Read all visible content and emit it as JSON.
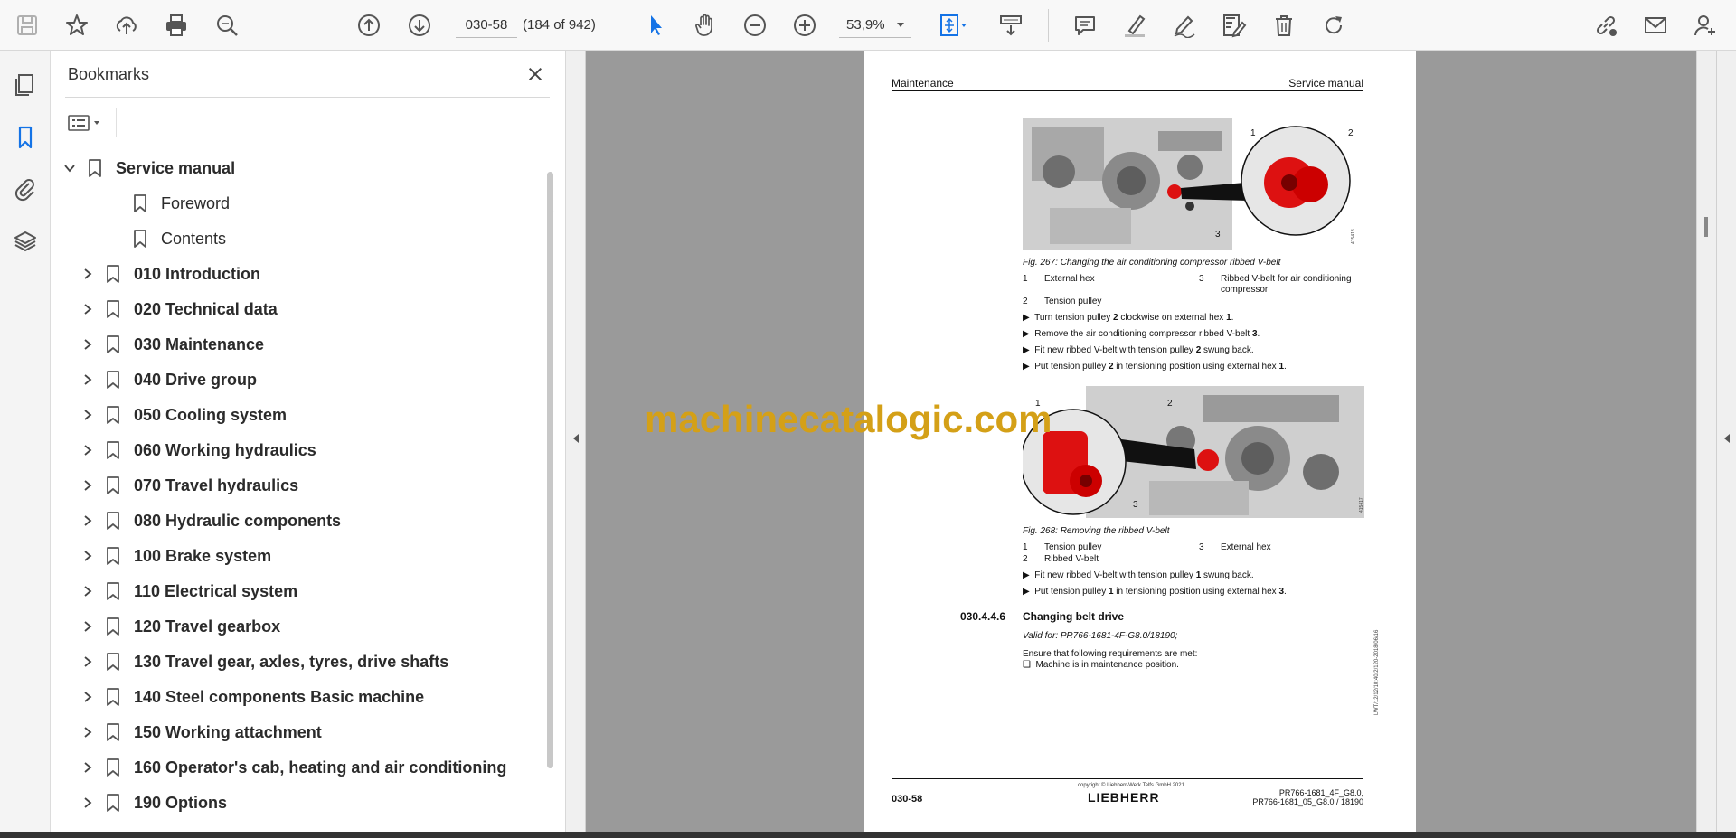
{
  "toolbar": {
    "page_number": "030-58",
    "page_count": "(184 of 942)",
    "zoom": "53,9%"
  },
  "bookmarks": {
    "title": "Bookmarks",
    "items": [
      {
        "label": "Service manual",
        "bold": true,
        "level": 0,
        "expanded": true
      },
      {
        "label": "Foreword",
        "bold": false,
        "level": 1,
        "expandable": false
      },
      {
        "label": "Contents",
        "bold": false,
        "level": 1,
        "expandable": false
      },
      {
        "label": "010 Introduction",
        "bold": true,
        "level": 1,
        "expandable": true
      },
      {
        "label": "020 Technical data",
        "bold": true,
        "level": 1,
        "expandable": true
      },
      {
        "label": "030 Maintenance",
        "bold": true,
        "level": 1,
        "expandable": true
      },
      {
        "label": "040 Drive group",
        "bold": true,
        "level": 1,
        "expandable": true
      },
      {
        "label": "050 Cooling system",
        "bold": true,
        "level": 1,
        "expandable": true
      },
      {
        "label": "060 Working hydraulics",
        "bold": true,
        "level": 1,
        "expandable": true
      },
      {
        "label": "070 Travel hydraulics",
        "bold": true,
        "level": 1,
        "expandable": true
      },
      {
        "label": "080 Hydraulic components",
        "bold": true,
        "level": 1,
        "expandable": true
      },
      {
        "label": "100 Brake system",
        "bold": true,
        "level": 1,
        "expandable": true
      },
      {
        "label": "110 Electrical system",
        "bold": true,
        "level": 1,
        "expandable": true
      },
      {
        "label": "120 Travel gearbox",
        "bold": true,
        "level": 1,
        "expandable": true
      },
      {
        "label": "130 Travel gear, axles, tyres, drive shafts",
        "bold": true,
        "level": 1,
        "expandable": true
      },
      {
        "label": "140 Steel components Basic machine",
        "bold": true,
        "level": 1,
        "expandable": true
      },
      {
        "label": "150 Working attachment",
        "bold": true,
        "level": 1,
        "expandable": true
      },
      {
        "label": "160 Operator's cab, heating and air conditioning",
        "bold": true,
        "level": 1,
        "expandable": true
      },
      {
        "label": "190 Options",
        "bold": true,
        "level": 1,
        "expandable": true
      }
    ]
  },
  "document": {
    "header_left": "Maintenance",
    "header_right": "Service manual",
    "fig1": {
      "caption": "Fig. 267: Changing the air conditioning compressor ribbed V-belt",
      "id": "415418",
      "callouts": [
        "1",
        "2",
        "3"
      ],
      "legend": [
        {
          "n": "1",
          "text": "External hex"
        },
        {
          "n": "3",
          "text": "Ribbed V-belt for air conditioning compressor"
        },
        {
          "n": "2",
          "text": "Tension pulley"
        }
      ],
      "steps": [
        {
          "pre": "Turn tension pulley ",
          "b": "2",
          "mid": " clockwise on external hex ",
          "b2": "1",
          "post": "."
        },
        {
          "pre": "Remove the air conditioning compressor ribbed V-belt ",
          "b": "3",
          "mid": ".",
          "b2": "",
          "post": ""
        },
        {
          "pre": "Fit new ribbed V-belt with tension pulley ",
          "b": "2",
          "mid": " swung back.",
          "b2": "",
          "post": ""
        },
        {
          "pre": "Put tension pulley ",
          "b": "2",
          "mid": " in tensioning position using external hex ",
          "b2": "1",
          "post": "."
        }
      ]
    },
    "fig2": {
      "caption": "Fig. 268: Removing the ribbed V-belt",
      "id": "415417",
      "callouts": [
        "1",
        "2",
        "3"
      ],
      "legend": [
        {
          "n": "1",
          "text": "Tension pulley"
        },
        {
          "n": "3",
          "text": "External hex"
        },
        {
          "n": "2",
          "text": "Ribbed V-belt"
        }
      ],
      "steps": [
        {
          "pre": "Fit new ribbed V-belt with tension pulley ",
          "b": "1",
          "mid": " swung back.",
          "b2": "",
          "post": ""
        },
        {
          "pre": "Put tension pulley ",
          "b": "1",
          "mid": " in tensioning position using external hex ",
          "b2": "3",
          "post": "."
        }
      ]
    },
    "section_number": "030.4.4.6",
    "section_title": "Changing belt drive",
    "valid_for": "Valid for: PR766-1681-4F-G8.0/18190;",
    "requirements_intro": "Ensure that following requirements are met:",
    "requirement_1": "Machine is in maintenance position.",
    "side_code": "LWT/12/12/10:40/2/120-2018/06/16",
    "footer_page": "030-58",
    "footer_copyright": "copyright © Liebherr-Werk Telfs GmbH 2021",
    "footer_logo": "LIEBHERR",
    "footer_model_1": "PR766-1681_4F_G8.0,",
    "footer_model_2": "PR766-1681_05_G8.0 / 18190"
  },
  "watermark": "machinecatalogic.com",
  "icons": [
    "save-icon",
    "star-icon",
    "upload-icon",
    "print-icon",
    "zoom-search-icon",
    "arrow-up-icon",
    "arrow-down-icon",
    "cursor-icon",
    "hand-icon",
    "zoom-out-icon",
    "zoom-in-icon",
    "fit-page-icon",
    "scroll-icon",
    "comment-icon",
    "highlight-icon",
    "sign-icon",
    "edit-icon",
    "delete-icon",
    "rotate-icon",
    "share-link-icon",
    "mail-icon",
    "account-icon"
  ]
}
